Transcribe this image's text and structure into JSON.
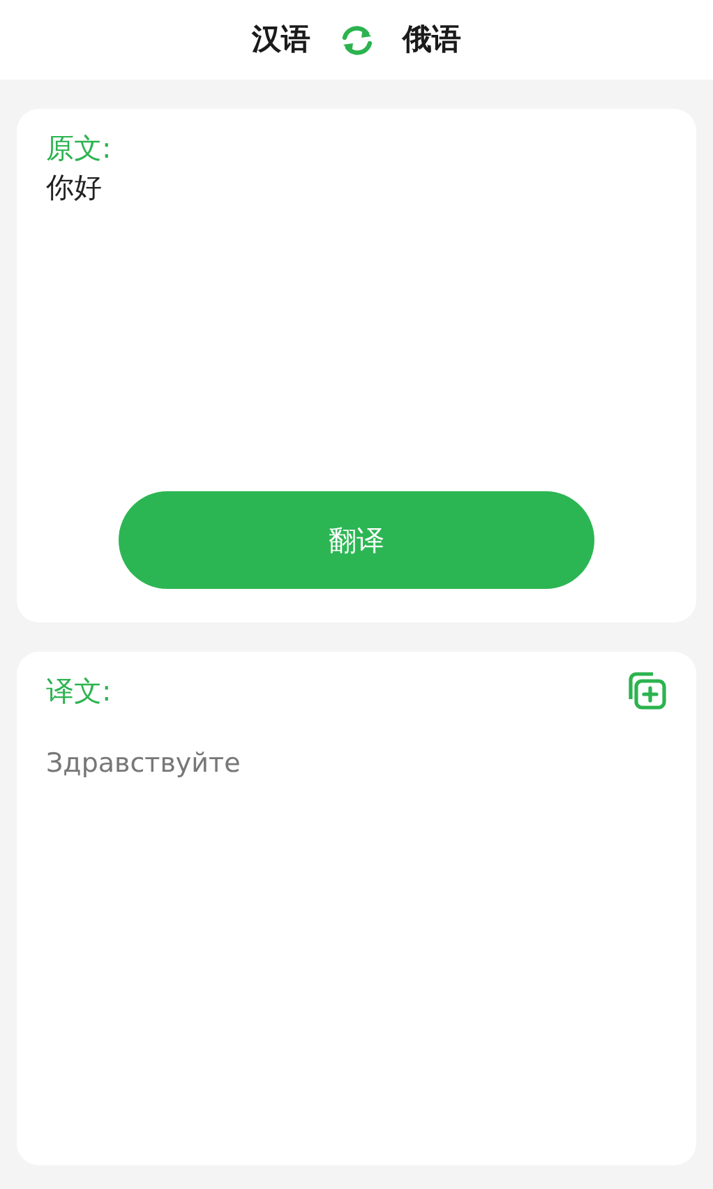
{
  "header": {
    "source_language": "汉语",
    "target_language": "俄语"
  },
  "source": {
    "label": "原文:",
    "text": "你好"
  },
  "translate_button": "翻译",
  "result": {
    "label": "译文:",
    "text": "Здравствуйте"
  }
}
